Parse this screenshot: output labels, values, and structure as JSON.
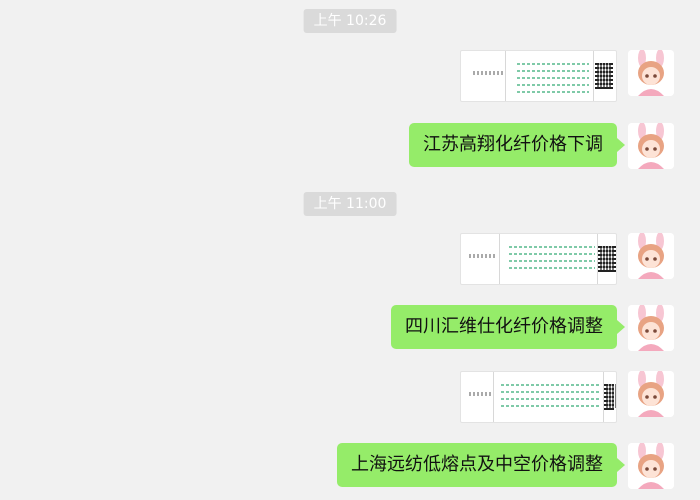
{
  "timestamps": [
    "上午 10:26",
    "上午 11:00"
  ],
  "messages": [
    {
      "type": "image",
      "label": "document-image"
    },
    {
      "type": "text",
      "text": "江苏高翔化纤价格下调"
    },
    {
      "type": "image",
      "label": "document-image"
    },
    {
      "type": "text",
      "text": "四川汇维仕化纤价格调整"
    },
    {
      "type": "image",
      "label": "document-image"
    },
    {
      "type": "text",
      "text": "上海远纺低熔点及中空价格调整"
    }
  ],
  "colors": {
    "background": "#f1f1f1",
    "bubble": "#95ec69",
    "timestamp_bg": "#dadada",
    "avatar_pink": "#f4a9bd"
  },
  "icons": {
    "avatar": "bunny-girl-avatar-icon"
  }
}
